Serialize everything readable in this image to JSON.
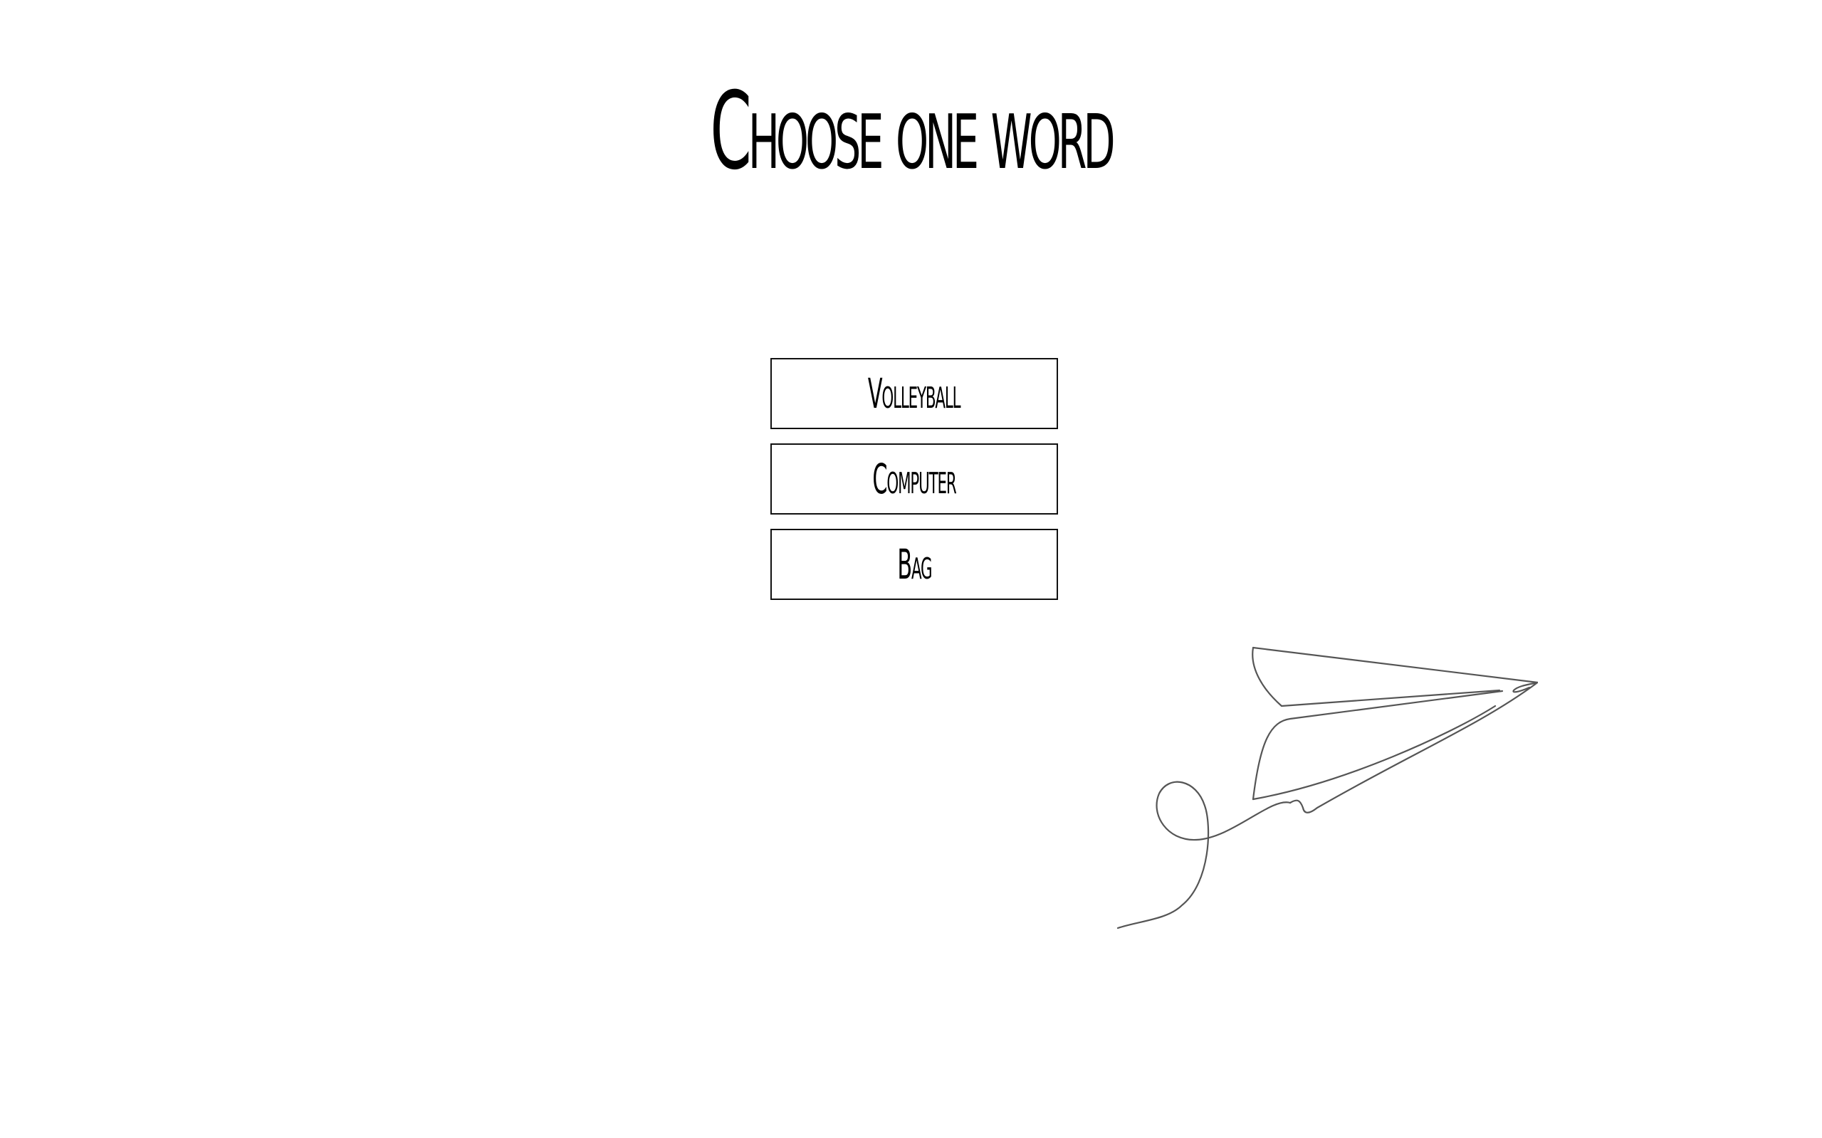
{
  "page": {
    "title": "Choose one word"
  },
  "words": [
    {
      "label": "Volleyball"
    },
    {
      "label": "Computer"
    },
    {
      "label": "Bag"
    }
  ],
  "decoration": {
    "icon": "paper-plane-icon",
    "stroke_color": "#555555"
  }
}
